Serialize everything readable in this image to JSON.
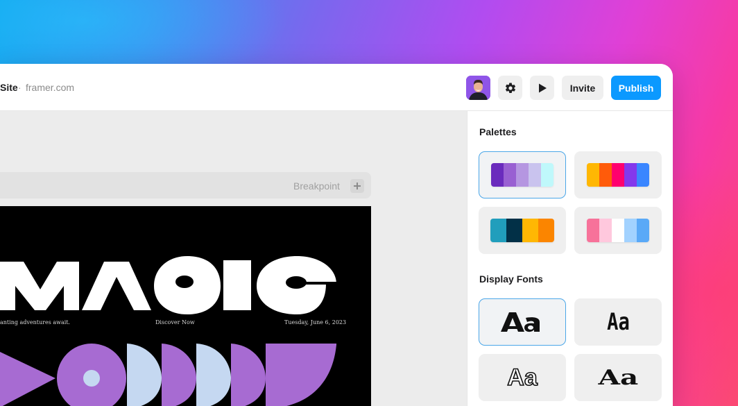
{
  "site": {
    "title": "Site",
    "separator": "·",
    "domain": "framer.com"
  },
  "toolbar": {
    "avatar_icon": "user-avatar",
    "settings_icon": "gear-icon",
    "preview_icon": "play-icon",
    "invite_label": "Invite",
    "publish_label": "Publish",
    "publish_color": "#0b99ff"
  },
  "canvas": {
    "breakpoint_label": "Breakpoint",
    "preview": {
      "headline": "MAGIC",
      "tagline": "anting adventures await.",
      "cta": "Discover Now",
      "date": "Tuesday, June 6, 2023"
    }
  },
  "panel": {
    "palettes_heading": "Palettes",
    "palettes": [
      {
        "selected": true,
        "colors": [
          "#6a2bbd",
          "#9960d2",
          "#b596e1",
          "#c9c3ee",
          "#bff8fb"
        ]
      },
      {
        "selected": false,
        "colors": [
          "#ffb703",
          "#ff5b0a",
          "#ff006e",
          "#8338ec",
          "#3a86ff"
        ]
      },
      {
        "selected": false,
        "colors": [
          "#219ebc",
          "#023047",
          "#ffb703",
          "#fb8500"
        ]
      },
      {
        "selected": false,
        "colors": [
          "#f7729a",
          "#ffc8dd",
          "#ffffff",
          "#a2d2ff",
          "#5aa9f7"
        ]
      }
    ],
    "fonts_heading": "Display Fonts",
    "fonts": [
      {
        "sample": "Aa",
        "selected": true
      },
      {
        "sample": "Aa",
        "selected": false
      },
      {
        "sample": "Aa",
        "selected": false
      },
      {
        "sample": "Aa",
        "selected": false
      }
    ]
  }
}
